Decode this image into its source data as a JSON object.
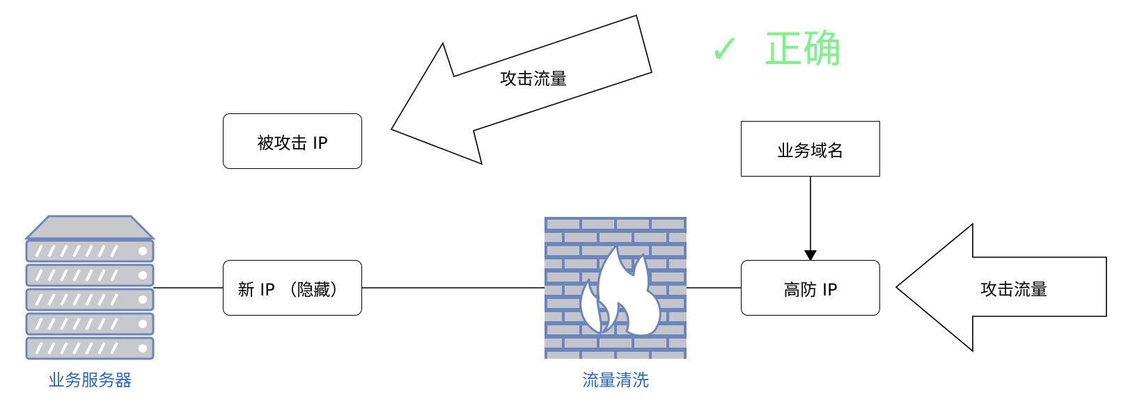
{
  "header": {
    "check_mark": "✓",
    "verdict": "正确",
    "verdict_color": "#7ef28a"
  },
  "nodes": {
    "attacked_ip": "被攻击 IP",
    "new_ip": "新 IP （隐藏）",
    "business_domain": "业务域名",
    "high_defense_ip": "高防 IP"
  },
  "arrows": {
    "attack_traffic_top": "攻击流量",
    "attack_traffic_right": "攻击流量"
  },
  "captions": {
    "server": "业务服务器",
    "scrubbing": "流量清洗",
    "caption_color": "#2a66c4"
  },
  "icons": {
    "server": "server-rack-icon",
    "firewall": "firewall-icon",
    "server_fill": "#c8c9cc",
    "server_stroke": "#6c86bb",
    "firewall_fill": "#6c86bb",
    "brick_fill": "#c2c5cb"
  }
}
